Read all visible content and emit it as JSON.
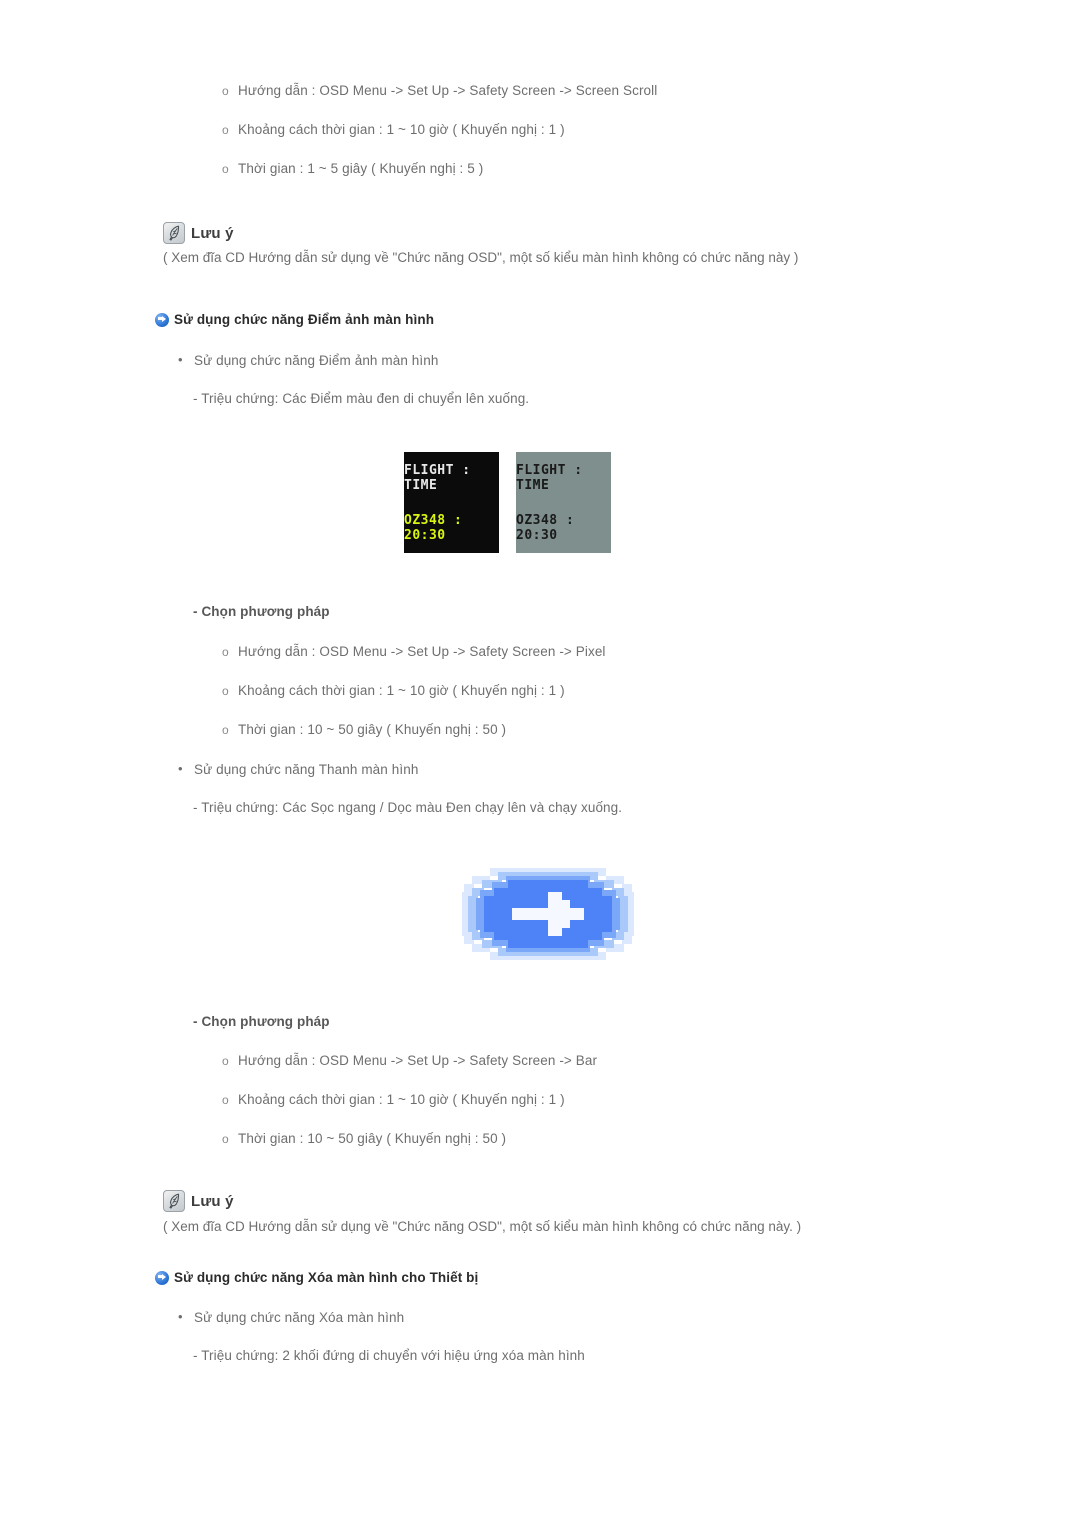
{
  "document": {
    "language": "vi",
    "background_color": "#ffffff",
    "text_color": "#6e6e6e",
    "heading_color": "#2b2b2b",
    "accent_color": "#2a74d4"
  },
  "scroll_method": {
    "items": [
      "Hướng dẫn : OSD Menu -> Set Up -> Safety Screen -> Screen Scroll",
      "Khoảng cách thời gian : 1 ~ 10 giờ ( Khuyến nghị : 1 )",
      "Thời gian : 1 ~ 5 giây ( Khuyến nghị : 5 )"
    ]
  },
  "note_1": {
    "icon": "note-quill-icon",
    "title": "Lưu ý",
    "body": "( Xem đĩa CD Hướng dẫn sử dụng về \"Chức năng OSD\", một số kiểu màn hình không có chức năng này )"
  },
  "section_pixel": {
    "bullet_icon": "blue-arrow-bullet-icon",
    "heading": "Sử dụng chức năng Điểm ảnh màn hình",
    "bullet": "Sử dụng chức năng Điểm ảnh màn hình",
    "symptom": "- Triệu chứng: Các Điểm màu đen di chuyển lên xuống.",
    "figure": {
      "name": "flight-information-display-figure",
      "panel_dark": {
        "line1": "FLIGHT : TIME",
        "line2": "OZ348 : 20:30",
        "background": "#0b0b0b",
        "line1_color": "#e8e8e8",
        "line2_color": "#d9f511"
      },
      "panel_gray": {
        "line1": "FLIGHT : TIME",
        "line2": "OZ348 : 20:30",
        "background": "#7e8f8d",
        "line1_color": "#1a1a1a",
        "line2_color": "#1a1a1a"
      }
    },
    "method_title": "- Chọn phương pháp",
    "method_items": [
      "Hướng dẫn : OSD Menu -> Set Up -> Safety Screen -> Pixel",
      "Khoảng cách thời gian : 1 ~ 10 giờ ( Khuyến nghị : 1 )",
      "Thời gian : 10 ~ 50 giây ( Khuyến nghị : 50 )"
    ]
  },
  "section_bar": {
    "bullet": "Sử dụng chức năng Thanh màn hình",
    "symptom": "- Triệu chứng: Các Sọc ngang / Dọc màu Đen chạy lên và chạy xuống.",
    "figure": {
      "name": "blue-oval-arrow-figure",
      "oval_color": "#4d83f7",
      "arrow_color": "#f5f9ff"
    },
    "method_title": "- Chọn phương pháp",
    "method_items": [
      "Hướng dẫn : OSD Menu -> Set Up -> Safety Screen -> Bar",
      "Khoảng cách thời gian : 1 ~ 10 giờ ( Khuyến nghị : 1 )",
      "Thời gian : 10 ~ 50 giây ( Khuyến nghị : 50 )"
    ]
  },
  "note_2": {
    "icon": "note-quill-icon",
    "title": "Lưu ý",
    "body": "( Xem đĩa CD Hướng dẫn sử dụng về \"Chức năng OSD\", một số kiểu màn hình không có chức năng này. )"
  },
  "section_eraser": {
    "bullet_icon": "blue-arrow-bullet-icon",
    "heading": "Sử dụng chức năng Xóa màn hình cho Thiết bị",
    "bullet": "Sử dụng chức năng Xóa màn hình",
    "symptom": "- Triệu chứng: 2 khối đứng di chuyển với hiệu ứng xóa màn hình"
  },
  "markers": {
    "circle": "o",
    "disc": "•"
  }
}
